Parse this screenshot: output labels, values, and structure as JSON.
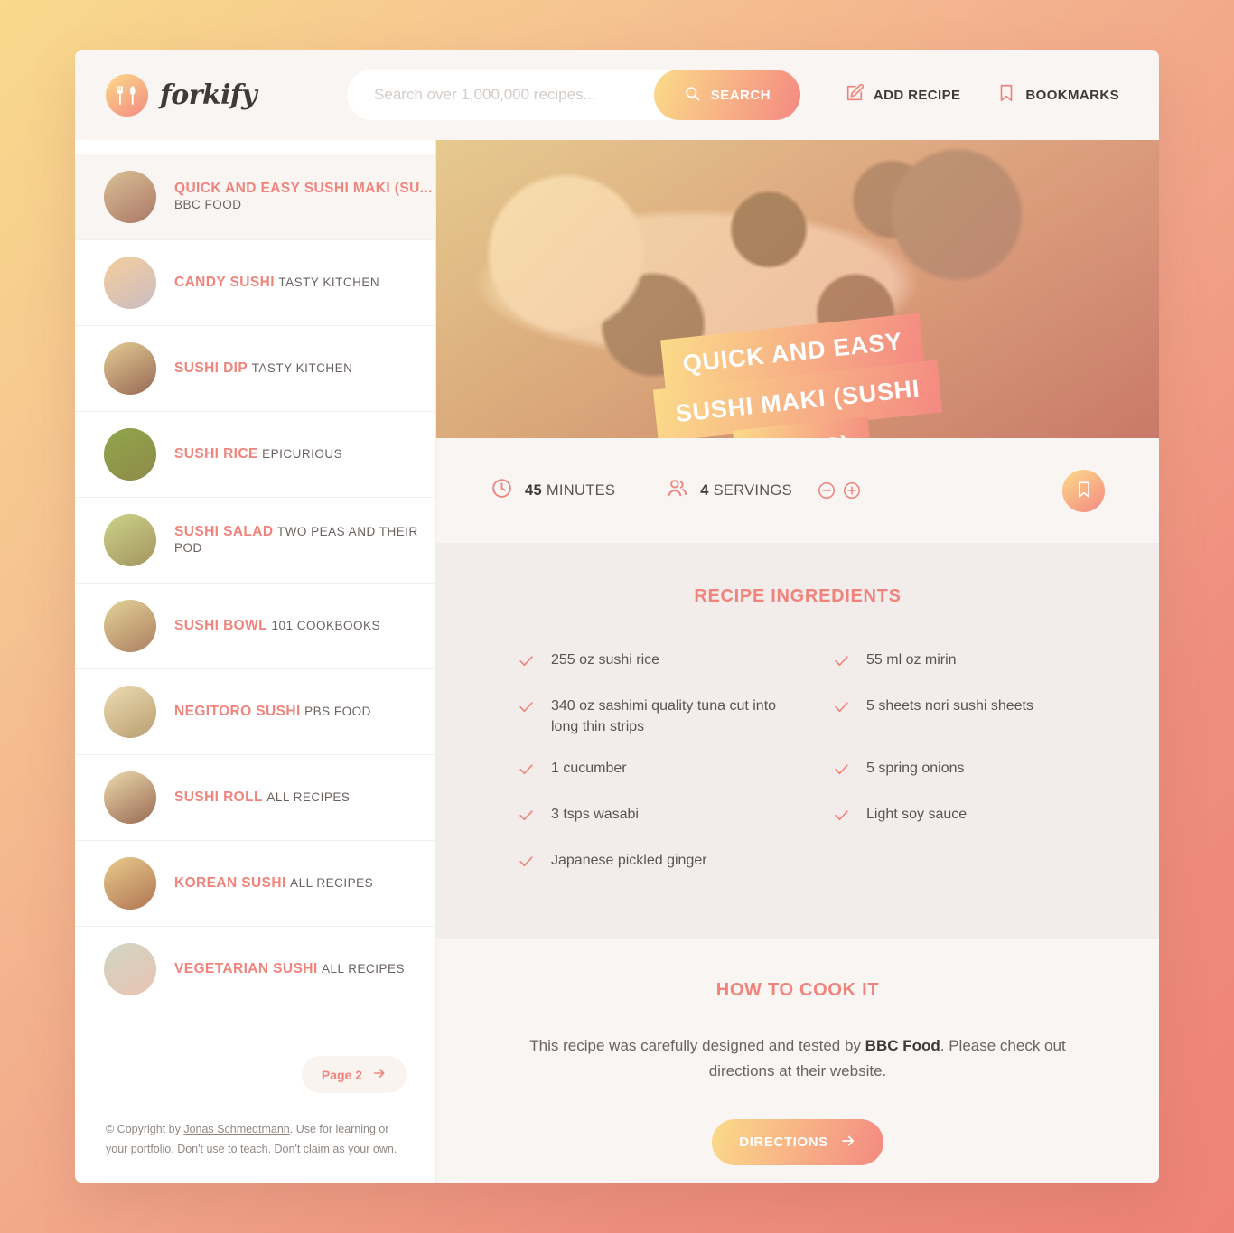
{
  "brand": {
    "name": "forkify",
    "icon": "fork-spoon-icon"
  },
  "search": {
    "placeholder": "Search over 1,000,000 recipes...",
    "value": "",
    "button_label": "SEARCH",
    "icon": "search-icon"
  },
  "nav": {
    "add_recipe": {
      "label": "ADD RECIPE",
      "icon": "edit-square-icon"
    },
    "bookmarks": {
      "label": "BOOKMARKS",
      "icon": "bookmark-icon"
    }
  },
  "sidebar": {
    "results": [
      {
        "title": "QUICK AND EASY SUSHI MAKI (SU...",
        "publisher": "BBC FOOD",
        "active": true
      },
      {
        "title": "CANDY SUSHI",
        "publisher": "TASTY KITCHEN",
        "active": false
      },
      {
        "title": "SUSHI DIP",
        "publisher": "TASTY KITCHEN",
        "active": false
      },
      {
        "title": "SUSHI RICE",
        "publisher": "EPICURIOUS",
        "active": false
      },
      {
        "title": "SUSHI SALAD",
        "publisher": "TWO PEAS AND THEIR POD",
        "active": false
      },
      {
        "title": "SUSHI BOWL",
        "publisher": "101 COOKBOOKS",
        "active": false
      },
      {
        "title": "NEGITORO SUSHI",
        "publisher": "PBS FOOD",
        "active": false
      },
      {
        "title": "SUSHI ROLL",
        "publisher": "ALL RECIPES",
        "active": false
      },
      {
        "title": "KOREAN SUSHI",
        "publisher": "ALL RECIPES",
        "active": false
      },
      {
        "title": "VEGETARIAN SUSHI",
        "publisher": "ALL RECIPES",
        "active": false
      }
    ],
    "pagination": {
      "label": "Page 2",
      "icon": "arrow-right-icon"
    },
    "copyright": {
      "prefix": "© Copyright by ",
      "author": "Jonas Schmedtmann",
      "suffix": ". Use for learning or your portfolio. Don't use to teach. Don't claim as your own."
    }
  },
  "recipe": {
    "title_lines": [
      "QUICK AND EASY",
      "SUSHI MAKI (SUSHI",
      "ROLLS)"
    ],
    "time": {
      "value": "45",
      "unit": "MINUTES",
      "icon": "clock-icon"
    },
    "servings": {
      "value": "4",
      "unit": "SERVINGS",
      "icon": "users-icon",
      "decrease_icon": "minus-circle-icon",
      "increase_icon": "plus-circle-icon"
    },
    "bookmark_icon": "bookmark-icon",
    "ingredients_title": "RECIPE INGREDIENTS",
    "ingredients_left": [
      "255 oz sushi rice",
      "340 oz sashimi quality tuna cut into long thin strips",
      "1 cucumber",
      "3 tsps wasabi",
      " Japanese pickled ginger"
    ],
    "ingredients_right": [
      "55 ml oz mirin",
      "5 sheets nori sushi sheets",
      "5 spring onions",
      " Light soy sauce"
    ],
    "cook_title": "HOW TO COOK IT",
    "cook_text_before": "This recipe was carefully designed and tested by ",
    "cook_publisher": "BBC Food",
    "cook_text_after": ". Please check out directions at their website.",
    "directions_label": "DIRECTIONS",
    "directions_icon": "arrow-right-icon"
  },
  "colors": {
    "accent": "#f0847c",
    "grad_start": "#fbdb89",
    "grad_end": "#f48982",
    "bg_start": "#f9d98b",
    "bg_end": "#ee8276",
    "panel": "#f9f5f3",
    "ingredients_bg": "#f2eceb"
  }
}
